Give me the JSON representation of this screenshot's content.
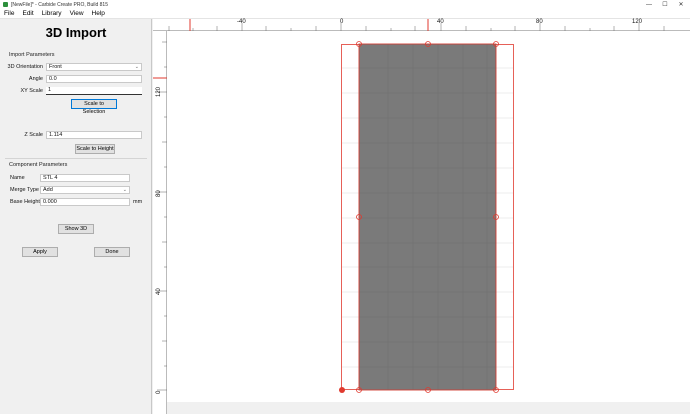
{
  "window": {
    "title": "[NewFile]* - Carbide Create PRO, Build 815",
    "minimize": "—",
    "maximize": "☐",
    "close": "✕"
  },
  "menu": [
    "File",
    "Edit",
    "Library",
    "View",
    "Help"
  ],
  "panel": {
    "title": "3D Import",
    "import_section": "Import Parameters",
    "orientation_label": "3D Orientation",
    "orientation_value": "Front",
    "angle_label": "Angle",
    "angle_value": "0.0",
    "xy_scale_label": "XY Scale",
    "xy_scale_value": "1",
    "scale_selection_button": "Scale to Selection",
    "z_scale_label": "Z Scale",
    "z_scale_value": "1.114",
    "scale_height_button": "Scale to Height",
    "component_section": "Component Parameters",
    "name_label": "Name",
    "name_value": "STL 4",
    "merge_label": "Merge Type",
    "merge_value": "Add",
    "base_height_label": "Base Height",
    "base_height_value": "0.000",
    "base_height_unit": "mm",
    "show3d_button": "Show 3D",
    "apply_button": "Apply",
    "done_button": "Done"
  },
  "ruler": {
    "top_labels": [
      "-40",
      "0",
      "40",
      "80",
      "120"
    ],
    "left_labels": [
      "120",
      "80",
      "40",
      "0"
    ]
  },
  "colors": {
    "accent_red": "#e03a2f",
    "part_fill": "#7a7a7a",
    "grid": "#dcdcdc"
  }
}
